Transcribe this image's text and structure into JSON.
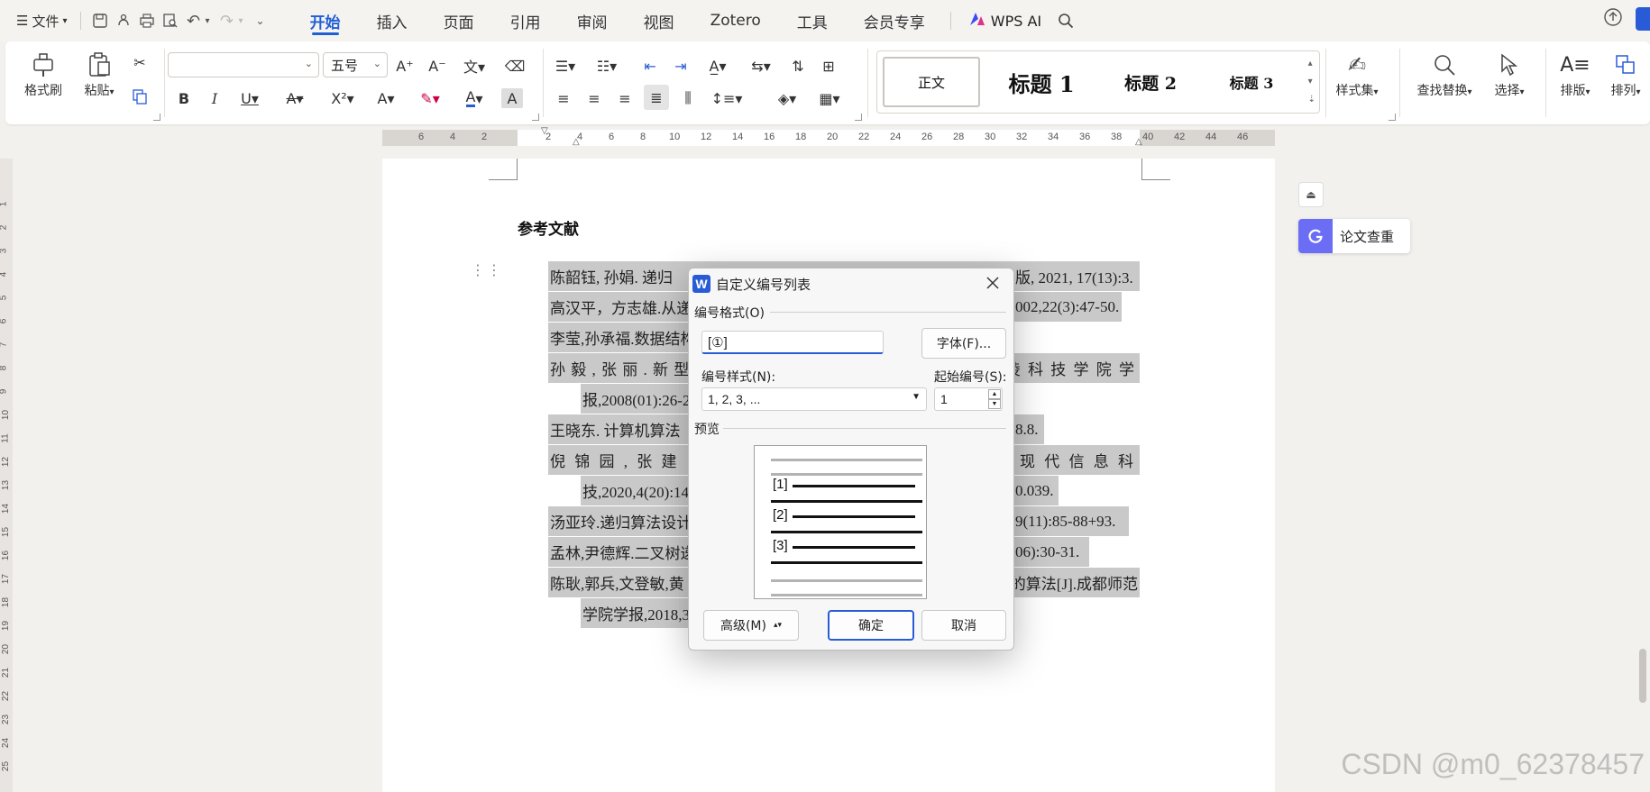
{
  "menubar": {
    "file_label": "文件",
    "tabs": [
      "开始",
      "插入",
      "页面",
      "引用",
      "审阅",
      "视图",
      "Zotero",
      "工具",
      "会员专享"
    ],
    "active_tab": "开始",
    "wps_ai_label": "WPS AI"
  },
  "ribbon": {
    "format_painter": "格式刷",
    "paste": "粘贴",
    "font_name": "",
    "font_size": "五号",
    "styles": {
      "normal": "正文",
      "heading1": "标题 1",
      "heading2": "标题 2",
      "heading3": "标题 3"
    },
    "style_set": "样式集",
    "find_replace": "查找替换",
    "select": "选择",
    "layout": "排版",
    "arrange": "排列"
  },
  "ruler": {
    "left_ticks": [
      "6",
      "4",
      "2"
    ],
    "right_ticks": [
      "2",
      "4",
      "6",
      "8",
      "10",
      "12",
      "14",
      "16",
      "18",
      "20",
      "22",
      "24",
      "26",
      "28",
      "30",
      "32",
      "34",
      "36",
      "38",
      "40",
      "42",
      "44",
      "46"
    ]
  },
  "vertical_ruler_ticks": [
    "1",
    "2",
    "3",
    "4",
    "5",
    "6",
    "7",
    "8",
    "9",
    "10",
    "11",
    "12",
    "13",
    "14",
    "15",
    "16",
    "17",
    "18",
    "19",
    "20",
    "21",
    "22",
    "23",
    "24",
    "25"
  ],
  "document": {
    "heading": "参考文献",
    "reference_lines": [
      {
        "left": "陈韶钰, 孙娟. 递归",
        "right": "版, 2021, 17(13):3."
      },
      {
        "left": "高汉平，方志雄.从递",
        "right": "002,22(3):47-50."
      },
      {
        "left": "李莹,孙承福.数据结构",
        "right": ""
      },
      {
        "left": "孙 毅 , 张 丽 . 新 型",
        "right": "陵 科 技 学 院 学"
      },
      {
        "left": "报,2008(01):26-2",
        "right": ""
      },
      {
        "left": "王晓东. 计算机算法",
        "right": "8.8."
      },
      {
        "left": "倪 锦 园 , 张 建",
        "right": "现 代 信 息 科"
      },
      {
        "left": "技,2020,4(20):14",
        "right": "0.039."
      },
      {
        "left": "汤亚玲.递归算法设计",
        "right": "9(11):85-88+93."
      },
      {
        "left": "孟林,尹德辉.二叉树递",
        "right": "06):30-31."
      },
      {
        "left": "陈耿,郭兵,文登敏,黄",
        "right": "的算法[J].成都师范"
      },
      {
        "left": "学院学报,2018,3",
        "right": ""
      }
    ]
  },
  "side_panel": {
    "paper_check_label": "论文查重"
  },
  "watermark": "CSDN @m0_62378457",
  "dialog": {
    "title": "自定义编号列表",
    "format_section": "编号格式(O)",
    "format_value": "[①]",
    "font_button": "字体(F)...",
    "style_label": "编号样式(N):",
    "style_value": "1, 2, 3, ...",
    "start_label": "起始编号(S):",
    "start_value": "1",
    "preview_section": "预览",
    "preview_numbers": [
      "[1]",
      "[2]",
      "[3]"
    ],
    "advanced_button": "高级(M)",
    "ok_button": "确定",
    "cancel_button": "取消"
  }
}
